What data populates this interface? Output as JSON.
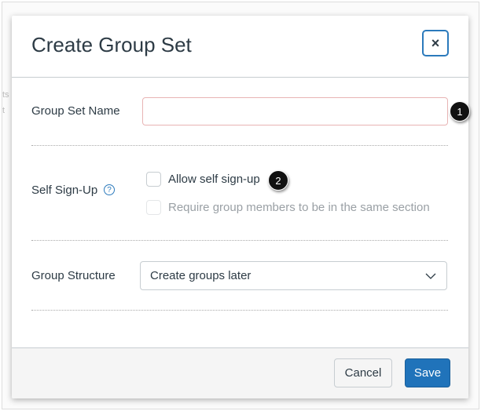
{
  "background": {
    "fragments": [
      "ts",
      "t"
    ]
  },
  "modal": {
    "title": "Create Group Set",
    "close_icon": "×",
    "fields": {
      "group_set_name": {
        "label": "Group Set Name",
        "value": ""
      },
      "self_signup": {
        "label": "Self Sign-Up",
        "help_icon": "?",
        "options": [
          {
            "label": "Allow self sign-up",
            "checked": false,
            "disabled": false
          },
          {
            "label": "Require group members to be in the same section",
            "checked": false,
            "disabled": true
          }
        ]
      },
      "group_structure": {
        "label": "Group Structure",
        "selected": "Create groups later"
      }
    },
    "footer": {
      "cancel": "Cancel",
      "save": "Save"
    },
    "colors": {
      "accent": "#2073ba",
      "text": "#2d3b45"
    }
  },
  "callouts": [
    "1",
    "2"
  ]
}
